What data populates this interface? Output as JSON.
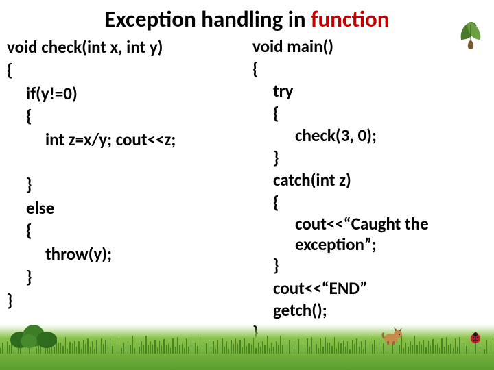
{
  "title": {
    "pre": "Exception handling in ",
    "accent": "function"
  },
  "left": {
    "l0": "void check(int x, int y)",
    "l1": "{",
    "l2": "if(y!=0)",
    "l3": "{",
    "l4": "int z=x/y; cout<<z;",
    "l5": "}",
    "l6": "else",
    "l7": "{",
    "l8": "throw(y);",
    "l9": "}",
    "l10": "}"
  },
  "right": {
    "l0": "void main()",
    "l1": "{",
    "l2": "try",
    "l3": "{",
    "l4": "check(3, 0);",
    "l5": "}",
    "l6": "catch(int z)",
    "l7": "{",
    "l8": "cout<<“Caught the exception”;",
    "l9": "}",
    "l10": "cout<<“END”",
    "l11": "getch();",
    "l12": "}"
  },
  "icons": {
    "leaf": "leaf-icon",
    "bush": "bush-icon",
    "dog": "dog-icon",
    "ladybug": "ladybug-icon"
  }
}
